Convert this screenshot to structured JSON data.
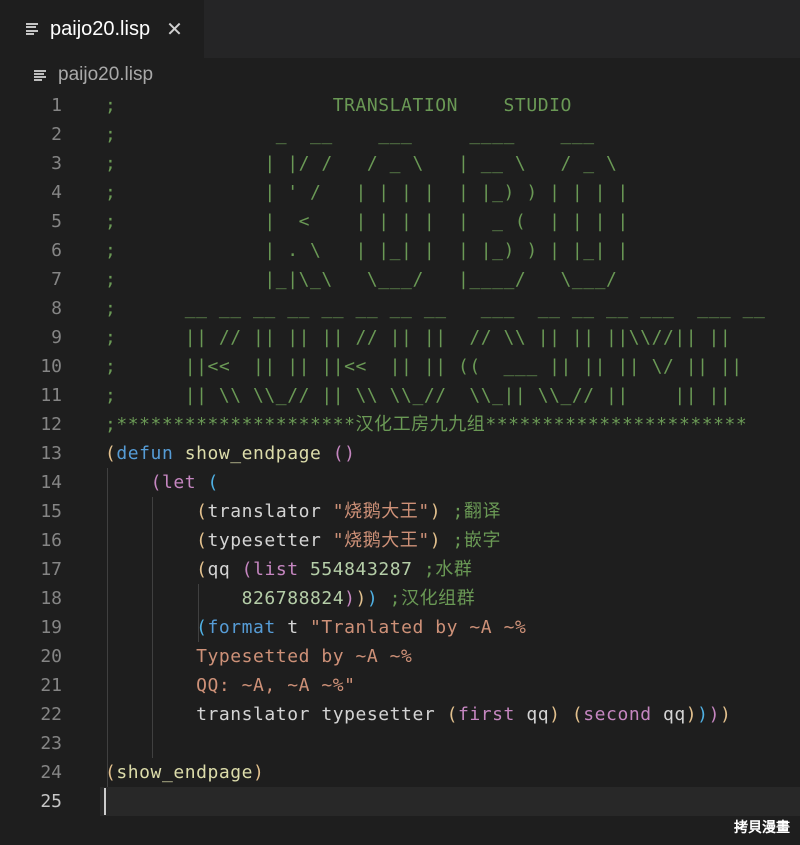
{
  "tab": {
    "label": "paijo20.lisp",
    "close_glyph": "✕"
  },
  "breadcrumb": {
    "label": "paijo20.lisp"
  },
  "line_numbers": [
    "1",
    "2",
    "3",
    "4",
    "5",
    "6",
    "7",
    "8",
    "9",
    "10",
    "11",
    "12",
    "13",
    "14",
    "15",
    "16",
    "17",
    "18",
    "19",
    "20",
    "21",
    "22",
    "23",
    "24",
    "25"
  ],
  "active_line": "25",
  "lines": [
    [
      {
        "t": ";                   TRANSLATION    STUDIO",
        "c": "cm"
      }
    ],
    [
      {
        "t": ";              _  __    ___     ____    ___",
        "c": "cm"
      }
    ],
    [
      {
        "t": ";             | |/ /   / _ \\   | __ \\   / _ \\",
        "c": "cm"
      }
    ],
    [
      {
        "t": ";             | ' /   | | | |  | |_) ) | | | |",
        "c": "cm"
      }
    ],
    [
      {
        "t": ";             |  <    | | | |  |  _ (  | | | |",
        "c": "cm"
      }
    ],
    [
      {
        "t": ";             | . \\   | |_| |  | |_) ) | |_| |",
        "c": "cm"
      }
    ],
    [
      {
        "t": ";             |_|\\_\\   \\___/   |____/   \\___/",
        "c": "cm"
      }
    ],
    [
      {
        "t": ";      __ __ __ __ __ __ __ __   ___  __ __ __ ___  ___ __",
        "c": "cm"
      }
    ],
    [
      {
        "t": ";      || // || || || // || ||  // \\\\ || || ||\\\\//|| ||",
        "c": "cm"
      }
    ],
    [
      {
        "t": ";      ||<<  || || ||<<  || || ((  ___ || || || \\/ || ||",
        "c": "cm"
      }
    ],
    [
      {
        "t": ";      || \\\\ \\\\_// || \\\\ \\\\_//  \\\\_|| \\\\_// ||    || ||",
        "c": "cm"
      }
    ],
    [
      {
        "t": ";*********************汉化工房九九组***********************",
        "c": "cm"
      }
    ],
    [
      {
        "t": "(",
        "c": "p1"
      },
      {
        "t": "defun",
        "c": "kw"
      },
      {
        "t": " show_endpage ",
        "c": "fn"
      },
      {
        "t": "()",
        "c": "p2"
      }
    ],
    [
      {
        "t": "    ",
        "c": "id"
      },
      {
        "t": "(",
        "c": "p2"
      },
      {
        "t": "let",
        "c": "bi"
      },
      {
        "t": " ",
        "c": "id"
      },
      {
        "t": "(",
        "c": "p3"
      }
    ],
    [
      {
        "t": "        ",
        "c": "id"
      },
      {
        "t": "(",
        "c": "p1"
      },
      {
        "t": "translator ",
        "c": "id"
      },
      {
        "t": "\"烧鹅大王\"",
        "c": "st"
      },
      {
        "t": ")",
        "c": "p1"
      },
      {
        "t": " ;翻译",
        "c": "cm"
      }
    ],
    [
      {
        "t": "        ",
        "c": "id"
      },
      {
        "t": "(",
        "c": "p1"
      },
      {
        "t": "typesetter ",
        "c": "id"
      },
      {
        "t": "\"烧鹅大王\"",
        "c": "st"
      },
      {
        "t": ")",
        "c": "p1"
      },
      {
        "t": " ;嵌字",
        "c": "cm"
      }
    ],
    [
      {
        "t": "        ",
        "c": "id"
      },
      {
        "t": "(",
        "c": "p1"
      },
      {
        "t": "qq ",
        "c": "id"
      },
      {
        "t": "(",
        "c": "p2"
      },
      {
        "t": "list",
        "c": "bi"
      },
      {
        "t": " 554843287",
        "c": "nm"
      },
      {
        "t": " ;水群",
        "c": "cm"
      }
    ],
    [
      {
        "t": "            826788824",
        "c": "nm"
      },
      {
        "t": ")",
        "c": "p2"
      },
      {
        "t": ")",
        "c": "p1"
      },
      {
        "t": ")",
        "c": "p3"
      },
      {
        "t": " ;汉化组群",
        "c": "cm"
      }
    ],
    [
      {
        "t": "        ",
        "c": "id"
      },
      {
        "t": "(",
        "c": "p3"
      },
      {
        "t": "format",
        "c": "kw"
      },
      {
        "t": " t ",
        "c": "id"
      },
      {
        "t": "\"Tranlated by ~A ~%",
        "c": "st"
      }
    ],
    [
      {
        "t": "        Typesetted by ~A ~%",
        "c": "st"
      }
    ],
    [
      {
        "t": "        QQ: ~A, ~A ~%\"",
        "c": "st"
      }
    ],
    [
      {
        "t": "        translator typesetter ",
        "c": "id"
      },
      {
        "t": "(",
        "c": "p1"
      },
      {
        "t": "first",
        "c": "bi"
      },
      {
        "t": " qq",
        "c": "id"
      },
      {
        "t": ")",
        "c": "p1"
      },
      {
        "t": " ",
        "c": "id"
      },
      {
        "t": "(",
        "c": "p1"
      },
      {
        "t": "second",
        "c": "bi"
      },
      {
        "t": " qq",
        "c": "id"
      },
      {
        "t": ")",
        "c": "p1"
      },
      {
        "t": ")",
        "c": "p3"
      },
      {
        "t": ")",
        "c": "p2"
      },
      {
        "t": ")",
        "c": "p1"
      }
    ],
    [],
    [
      {
        "t": "(",
        "c": "p1"
      },
      {
        "t": "show_endpage",
        "c": "fn"
      },
      {
        "t": ")",
        "c": "p1"
      }
    ],
    []
  ],
  "watermark": "拷貝漫畫",
  "colors": {
    "background": "#1e1e1e",
    "comment": "#6a9955",
    "keyword": "#569cd6",
    "function": "#dcdcaa",
    "string": "#ce9178",
    "number": "#b5cea8",
    "bracket_gold": "#e2c08d",
    "bracket_purple": "#c586c0",
    "bracket_blue": "#4fb0e3"
  },
  "icons": {
    "tab_file": "file-lines-icon",
    "breadcrumb_file": "file-lines-icon",
    "close": "close-icon"
  }
}
